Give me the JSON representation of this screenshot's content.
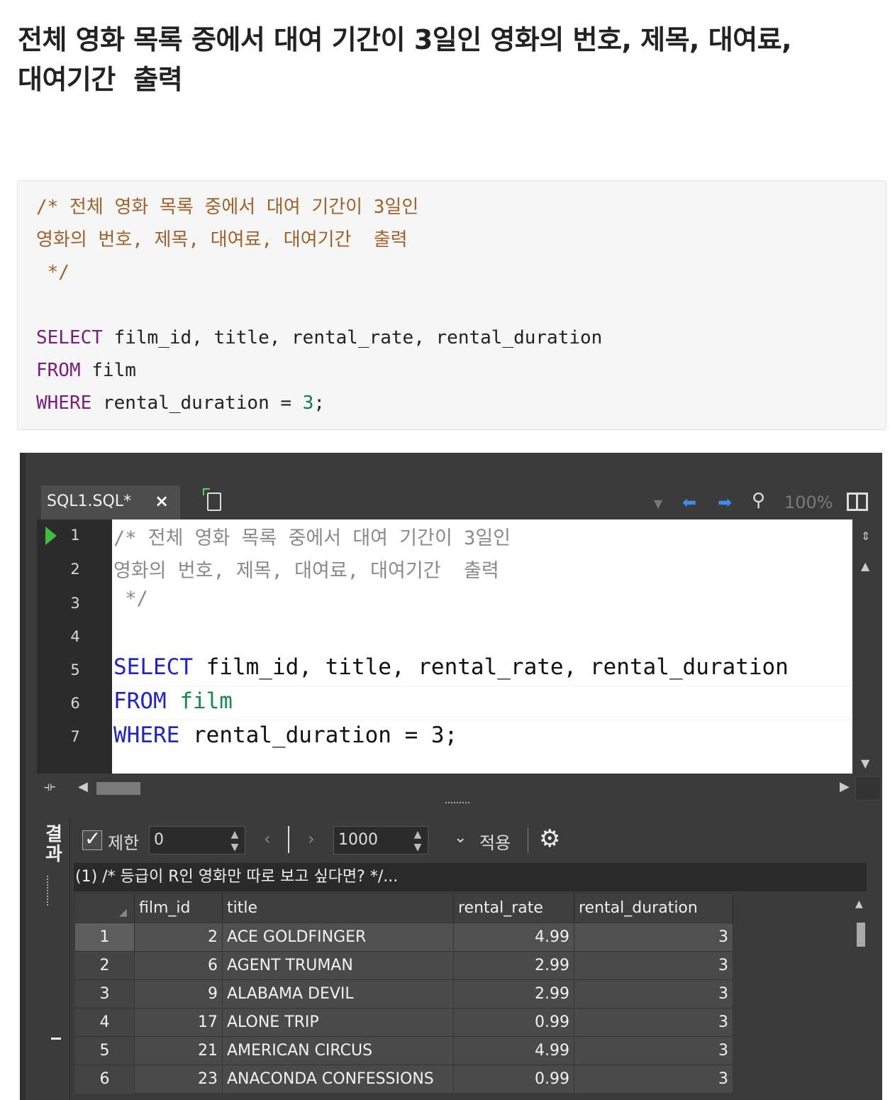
{
  "page": {
    "title": "전체 영화 목록 중에서 대여 기간이 3일인 영화의 번호, 제목, 대여료,\n대여기간  출력"
  },
  "code_block": {
    "comment_line1": "/* 전체 영화 목록 중에서 대여 기간이 3일인",
    "comment_line2": "영화의 번호, 제목, 대여료, 대여기간  출력",
    "comment_line3": " */",
    "kw_select": "SELECT",
    "select_cols": " film_id, title, rental_rate, rental_duration",
    "kw_from": "FROM",
    "from_table": " film",
    "kw_where": "WHERE",
    "where_cond": " rental_duration = ",
    "where_value": "3",
    "where_end": ";"
  },
  "ide": {
    "tab_label": "SQL1.SQL*",
    "close_icon": "×",
    "zoom_level": "100%",
    "line_numbers": [
      "1",
      "2",
      "3",
      "4",
      "5",
      "6",
      "7"
    ],
    "editor": {
      "line1": "/* 전체 영화 목록 중에서 대여 기간이 3일인",
      "line2": "영화의 번호, 제목, 대여료, 대여기간  출력",
      "line3": " */",
      "kw_select": "SELECT",
      "select_cols": " film_id, title, rental_rate, rental_duration",
      "kw_from": "FROM",
      "from_table": " film",
      "kw_where": "WHERE",
      "where_rest": " rental_duration = 3;"
    },
    "results": {
      "side_label": "결과",
      "limit_label": "제한",
      "limit_start": "0",
      "limit_count": "1000",
      "apply_label": "적용",
      "query_text": "(1) /* 등급이 R인 영화만 따로 보고 싶다면? */...",
      "columns": [
        "film_id",
        "title",
        "rental_rate",
        "rental_duration"
      ],
      "rows": [
        {
          "n": "1",
          "film_id": "2",
          "title": "ACE GOLDFINGER",
          "rental_rate": "4.99",
          "rental_duration": "3"
        },
        {
          "n": "2",
          "film_id": "6",
          "title": "AGENT TRUMAN",
          "rental_rate": "2.99",
          "rental_duration": "3"
        },
        {
          "n": "3",
          "film_id": "9",
          "title": "ALABAMA DEVIL",
          "rental_rate": "2.99",
          "rental_duration": "3"
        },
        {
          "n": "4",
          "film_id": "17",
          "title": "ALONE TRIP",
          "rental_rate": "0.99",
          "rental_duration": "3"
        },
        {
          "n": "5",
          "film_id": "21",
          "title": "AMERICAN CIRCUS",
          "rental_rate": "4.99",
          "rental_duration": "3"
        },
        {
          "n": "6",
          "film_id": "23",
          "title": "ANACONDA CONFESSIONS",
          "rental_rate": "0.99",
          "rental_duration": "3"
        }
      ]
    }
  }
}
